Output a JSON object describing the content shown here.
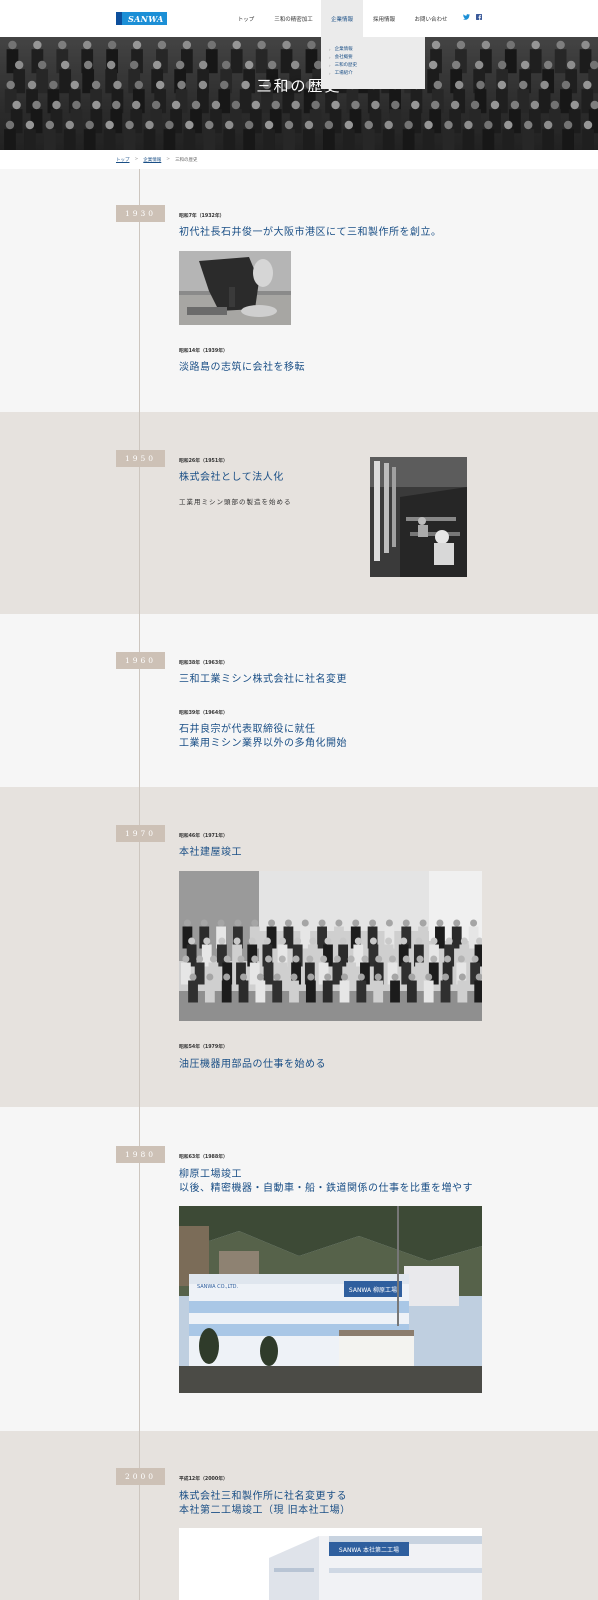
{
  "header": {
    "logo_text": "SANWA",
    "nav": [
      {
        "label": "トップ",
        "active": false
      },
      {
        "label": "三和の精密加工",
        "active": false
      },
      {
        "label": "企業情報",
        "active": true
      },
      {
        "label": "採用情報",
        "active": false
      },
      {
        "label": "お問い合わせ",
        "active": false
      }
    ],
    "social": [
      "twitter-icon",
      "facebook-icon"
    ]
  },
  "dropdown": {
    "items": [
      "企業情報",
      "会社概要",
      "三和の歴史",
      "工場紹介"
    ]
  },
  "hero": {
    "title": "三和の歴史"
  },
  "breadcrumb": {
    "home": "トップ",
    "parent": "企業情報",
    "current": "三和の歴史"
  },
  "timeline": [
    {
      "year": "1930",
      "entries": [
        {
          "era": "昭和7年（1932年）",
          "event": "初代社長石井俊一が大阪市港区にて三和製作所を創立。"
        },
        {
          "era": "昭和14年（1939年）",
          "event": "淡路島の志筑に会社を移転"
        }
      ]
    },
    {
      "year": "1950",
      "entries": [
        {
          "era": "昭和26年（1951年）",
          "event": "株式会社として法人化",
          "sub": "工業用ミシン頭部の製造を始める"
        }
      ]
    },
    {
      "year": "1960",
      "entries": [
        {
          "era": "昭和38年（1963年）",
          "event": "三和工業ミシン株式会社に社名変更"
        },
        {
          "era": "昭和39年（1964年）",
          "event_lines": [
            "石井良宗が代表取締役に就任",
            "工業用ミシン業界以外の多角化開始"
          ]
        }
      ]
    },
    {
      "year": "1970",
      "entries": [
        {
          "era": "昭和46年（1971年）",
          "event": "本社建屋竣工"
        },
        {
          "era": "昭和54年（1979年）",
          "event": "油圧機器用部品の仕事を始める"
        }
      ]
    },
    {
      "year": "1980",
      "entries": [
        {
          "era": "昭和63年（1988年）",
          "event_lines": [
            "柳原工場竣工",
            "以後、精密機器・自動車・船・鉄道関係の仕事を比重を増やす"
          ]
        }
      ]
    },
    {
      "year": "2000",
      "entries": [
        {
          "era": "平成12年（2000年）",
          "event_lines": [
            "株式会社三和製作所に社名変更する",
            "本社第二工場竣工（現 旧本社工場）"
          ]
        }
      ]
    }
  ],
  "photo_signs": {
    "factory_sign": "SANWA 柳原工場",
    "factory_company": "SANWA CO.,LTD.",
    "building_sign": "SANWA 本社第二工場"
  },
  "colors": {
    "accent": "#1a4f86",
    "badge": "#cdc1b6",
    "logo": "#1c8fd6",
    "band_dark": "#e6e2de",
    "band_light": "#f6f6f6"
  }
}
